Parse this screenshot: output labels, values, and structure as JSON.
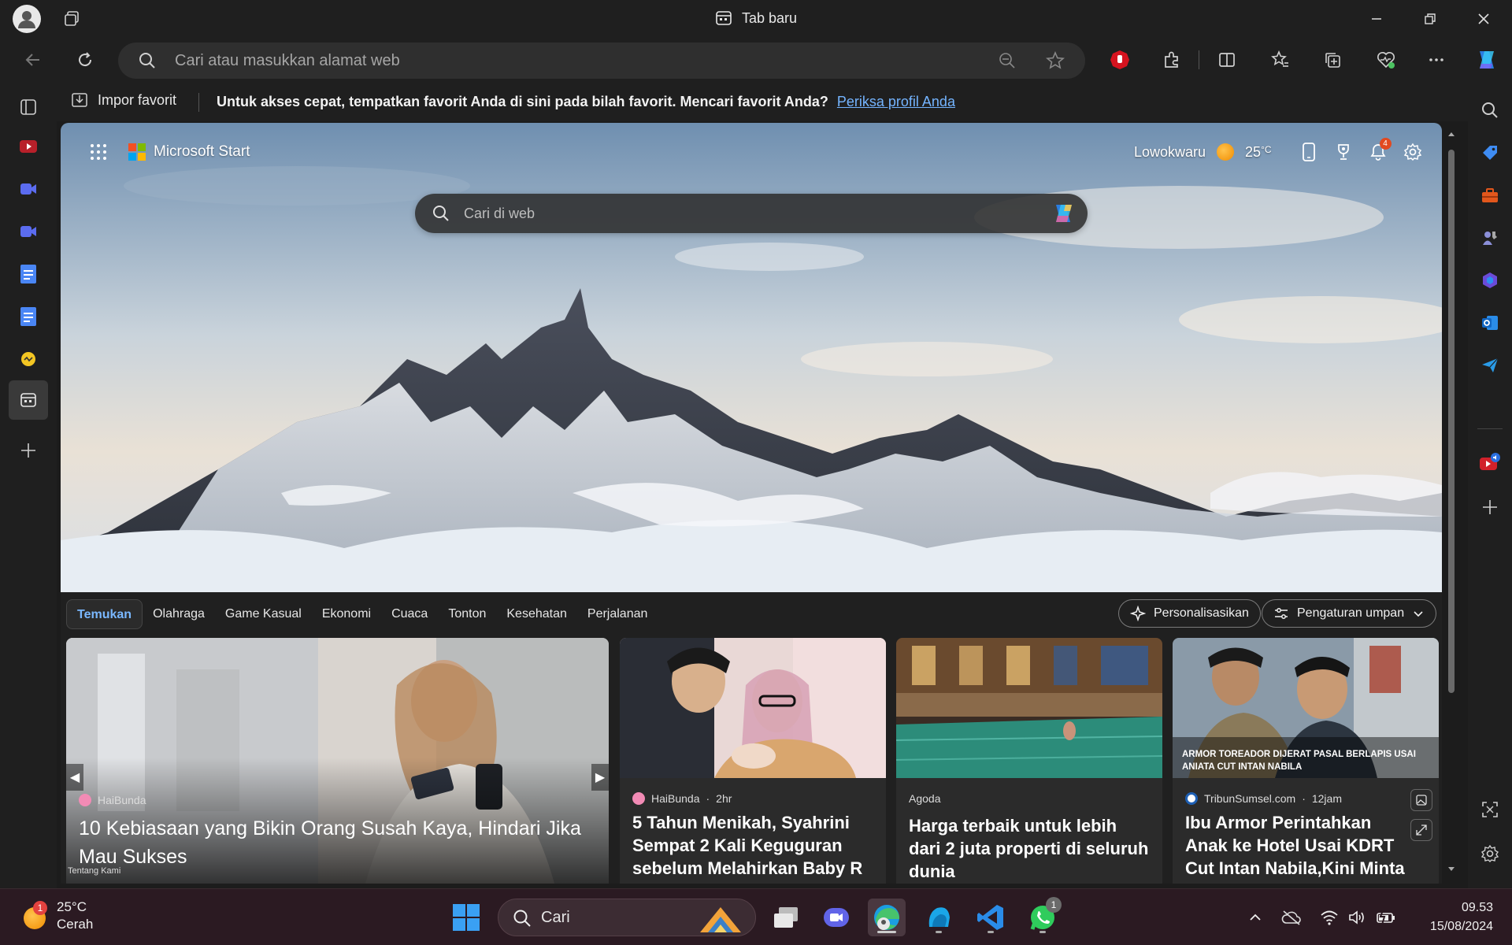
{
  "window": {
    "tab_title": "Tab baru"
  },
  "toolbar": {
    "address_placeholder": "Cari atau masukkan alamat web"
  },
  "favorites_bar": {
    "import_label": "Impor favorit",
    "message": "Untuk akses cepat, tempatkan favorit Anda di sini pada bilah favorit. Mencari favorit Anda?",
    "link_text": "Periksa profil Anda"
  },
  "start": {
    "brand": "Microsoft Start",
    "location": "Lowokwaru",
    "temperature": "25",
    "unit": "°C",
    "notification_count": "4",
    "search_placeholder": "Cari di web"
  },
  "feed": {
    "tabs": [
      "Temukan",
      "Olahraga",
      "Game Kasual",
      "Ekonomi",
      "Cuaca",
      "Tonton",
      "Kesehatan",
      "Perjalanan"
    ],
    "active_tab": "Temukan",
    "personalize_label": "Personalisasikan",
    "feed_settings_label": "Pengaturan umpan",
    "cards": [
      {
        "source": "HaiBunda",
        "time": "",
        "title": "10 Kebiasaan yang Bikin Orang Susah Kaya, Hindari Jika Mau Sukses",
        "footer": "Tentang Kami"
      },
      {
        "source": "HaiBunda",
        "time": "2hr",
        "title": "5 Tahun Menikah, Syahrini Sempat 2 Kali Keguguran sebelum Melahirkan Baby R"
      },
      {
        "source": "Agoda",
        "time": "",
        "title": "Harga terbaik untuk lebih dari 2 juta properti di seluruh dunia"
      },
      {
        "source": "TribunSumsel.com",
        "time": "12jam",
        "title": "Ibu Armor Perintahkan Anak ke Hotel Usai KDRT Cut Intan Nabila,Kini Minta Menantu...",
        "image_caption": "ARMOR TOREADOR DIJERAT PASAL BERLAPIS USAI ANIATA CUT INTAN NABILA"
      }
    ]
  },
  "taskbar": {
    "weather_temp": "25°C",
    "weather_desc": "Cerah",
    "weather_badge": "1",
    "search_placeholder": "Cari",
    "whatsapp_badge": "1",
    "time": "09.53",
    "date": "15/08/2024"
  },
  "colors": {
    "accent": "#74b4ff",
    "badge": "#e2491f"
  }
}
